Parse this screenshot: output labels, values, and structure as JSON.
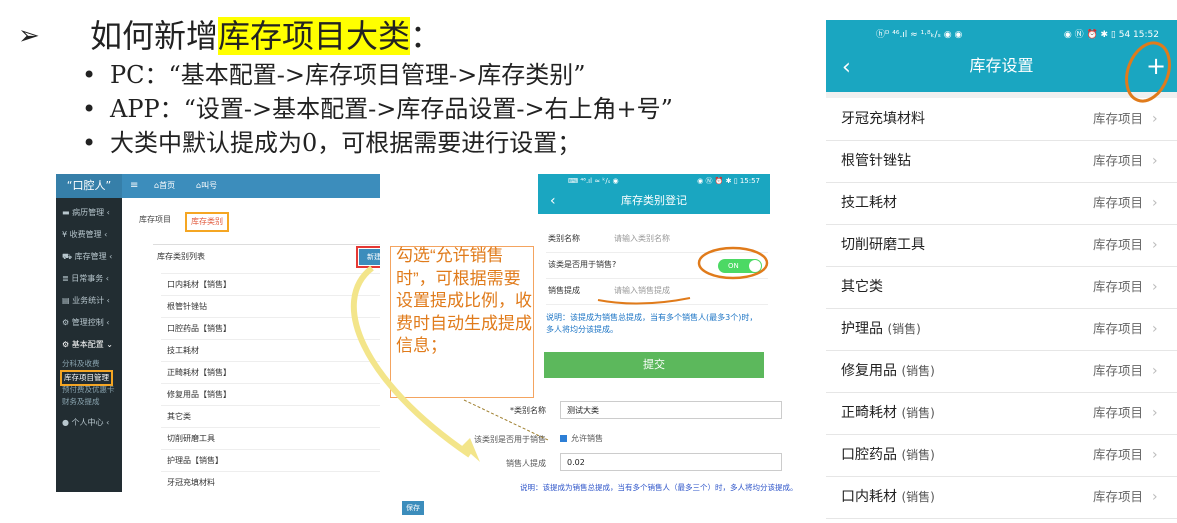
{
  "intro": {
    "arrow": "➢",
    "title_prefix": "如何新增",
    "title_highlight": "库存项目大类",
    "title_suffix": "：",
    "bullets": [
      "PC：“基本配置->库存项目管理->库存类别”",
      "APP：“设置->基本配置->库存品设置->右上角+号”",
      "大类中默认提成为0，可根据需要进行设置；"
    ],
    "bullet_dot": "•"
  },
  "pc": {
    "logo": "“口腔人”",
    "menu_icon": "≡",
    "nav": [
      "首页",
      "叫号"
    ],
    "sidebar": [
      "病历管理 ‹",
      "收费管理 ‹",
      "库存管理 ‹",
      "日常事务 ‹",
      "业务统计 ‹",
      "管理控制 ‹",
      "基本配置 ⌄"
    ],
    "sidebar_icons": [
      "▬",
      "¥",
      "⛟",
      "≣",
      "▤",
      "⚙",
      "⚙"
    ],
    "sub_items": [
      "分科及收费",
      "库存项目管理",
      "预付费及优惠卡",
      "财务及提成"
    ],
    "personal": "个人中心 ‹",
    "tabs": [
      "库存项目",
      "库存类别"
    ],
    "list_title": "库存类别列表",
    "new_button": "新建大类",
    "rows": [
      "口内耗材【销售】",
      "根管针锉钻",
      "口腔药品【销售】",
      "技工耗材",
      "正畸耗材【销售】",
      "修复用品【销售】",
      "其它类",
      "切削研磨工具",
      "护理品【销售】",
      "牙冠充填材料"
    ]
  },
  "callout": {
    "text": "勾选“允许销售时”，可根据需要设置提成比例，收费时自动生成提成信息；"
  },
  "mobile_form": {
    "status_left": "⌨ ⁴⁶.ıl ≈ ᵏ/ₛ ◉",
    "status_right": "◉ Ⓝ ⏰ ✱ ▯ 15:57",
    "back": "‹",
    "title": "库存类别登记",
    "name_label": "类别名称",
    "name_placeholder": "请输入类别名称",
    "sale_label": "该类是否用于销售?",
    "switch_label": "ON",
    "commission_label": "销售提成",
    "commission_placeholder": "请输入销售提成",
    "note": "说明：该提成为销售总提成，当有多个销售人(最多3个)时，多人将均分该提成。",
    "submit": "提交"
  },
  "pc_form": {
    "name_label": "*类别名称",
    "name_value": "测试大类",
    "sale_label": "该类别是否用于销售",
    "sale_check": "允许销售",
    "commission_label": "销售人提成",
    "commission_value": "0.02",
    "note": "说明：该提成为销售总提成，当有多个销售人（最多三个）时，多人将均分该提成。",
    "save": "保存"
  },
  "phone": {
    "status_left": "ⓗᴰ ⁴⁶.ıl ≈ ¹·⁸ₖ/ₛ ◉ ◉",
    "status_right": "◉ Ⓝ ⏰ ✱ ▯ 54 15:52",
    "back": "‹",
    "title": "库存设置",
    "plus": "+",
    "rows": [
      {
        "name": "牙冠充填材料",
        "sub": "",
        "value": "库存项目"
      },
      {
        "name": "根管针锉钻",
        "sub": "",
        "value": "库存项目"
      },
      {
        "name": "技工耗材",
        "sub": "",
        "value": "库存项目"
      },
      {
        "name": "切削研磨工具",
        "sub": "",
        "value": "库存项目"
      },
      {
        "name": "其它类",
        "sub": "",
        "value": "库存项目"
      },
      {
        "name": "护理品",
        "sub": "(销售)",
        "value": "库存项目"
      },
      {
        "name": "修复用品",
        "sub": "(销售)",
        "value": "库存项目"
      },
      {
        "name": "正畸耗材",
        "sub": "(销售)",
        "value": "库存项目"
      },
      {
        "name": "口腔药品",
        "sub": "(销售)",
        "value": "库存项目"
      },
      {
        "name": "口内耗材",
        "sub": "(销售)",
        "value": "库存项目"
      }
    ],
    "chevron": "›"
  },
  "colors": {
    "accent": "#1aa6c1",
    "pc_header": "#3c8dbc",
    "sidebar": "#222d32",
    "highlight": "#ffff00",
    "annot": "#e07b1b"
  }
}
